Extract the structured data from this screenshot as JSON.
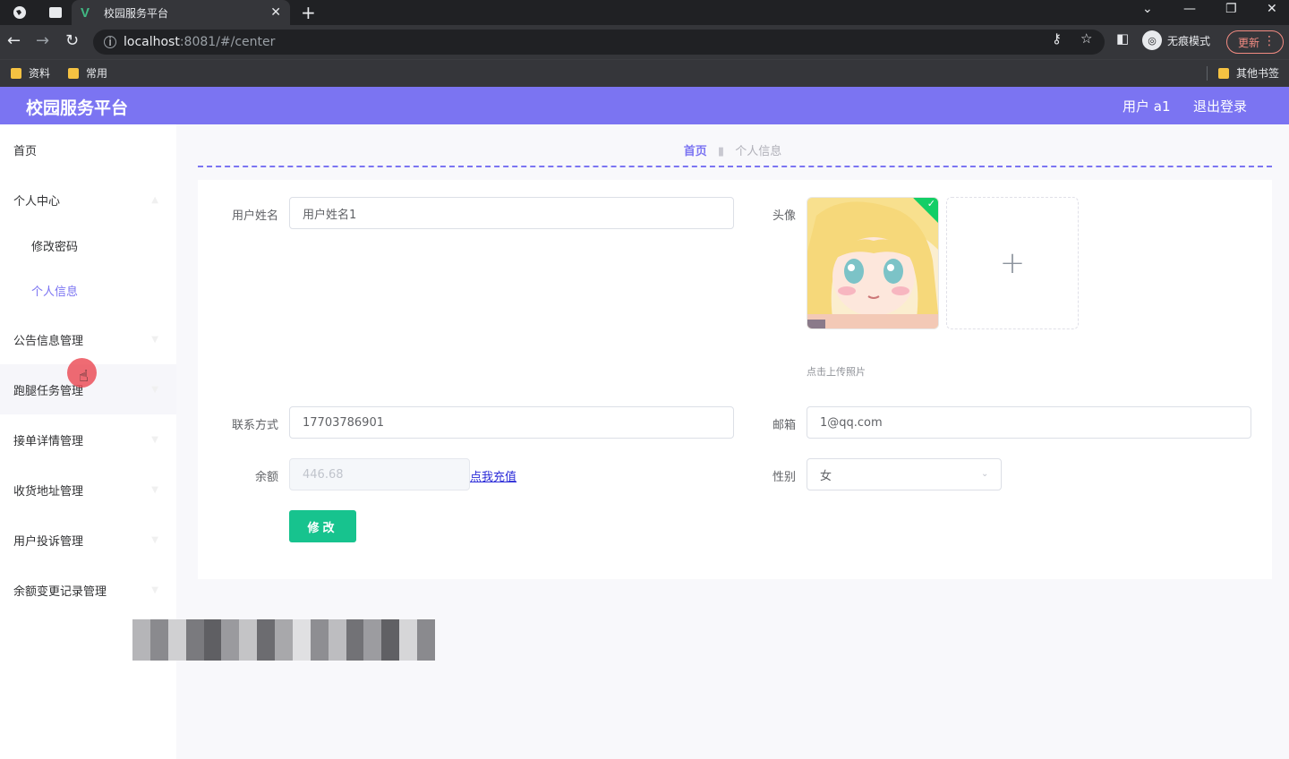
{
  "browser": {
    "tab_title": "校园服务平台",
    "url_host": "localhost",
    "url_path": ":8081/#/center",
    "incognito_label": "无痕模式",
    "update_label": "更新",
    "bookmarks": [
      "资料",
      "常用"
    ],
    "other_bookmarks": "其他书签"
  },
  "app": {
    "title": "校园服务平台",
    "user_label": "用户 a1",
    "logout_label": "退出登录"
  },
  "sidebar": {
    "items": [
      {
        "label": "首页"
      },
      {
        "label": "个人中心"
      },
      {
        "label": "修改密码"
      },
      {
        "label": "个人信息"
      },
      {
        "label": "公告信息管理"
      },
      {
        "label": "跑腿任务管理"
      },
      {
        "label": "接单详情管理"
      },
      {
        "label": "收货地址管理"
      },
      {
        "label": "用户投诉管理"
      },
      {
        "label": "余额变更记录管理"
      }
    ]
  },
  "breadcrumb": {
    "home": "首页",
    "current": "个人信息"
  },
  "form": {
    "username_label": "用户姓名",
    "username_value": "用户姓名1",
    "avatar_label": "头像",
    "upload_tip": "点击上传照片",
    "phone_label": "联系方式",
    "phone_value": "17703786901",
    "email_label": "邮箱",
    "email_value": "1@qq.com",
    "balance_label": "余额",
    "balance_value": "446.68",
    "recharge_label": "点我充值",
    "gender_label": "性别",
    "gender_value": "女",
    "submit_label": "修改"
  },
  "colors": {
    "header": "#7b74f2",
    "submit": "#17c38e",
    "active_menu": "#7b74f2"
  }
}
